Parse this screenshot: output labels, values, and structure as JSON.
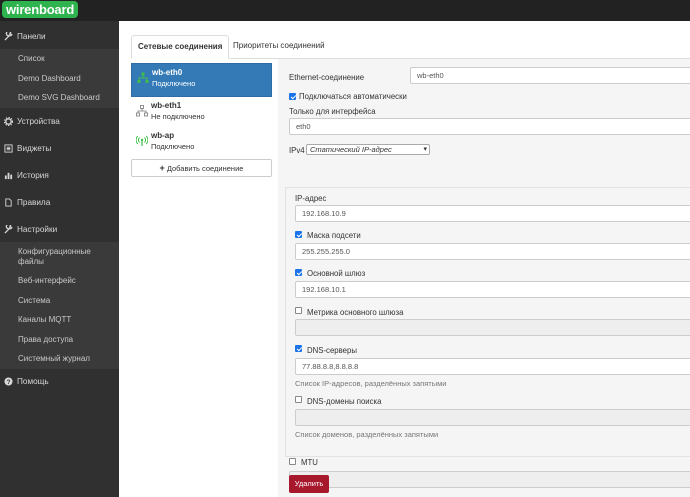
{
  "app": {
    "logo": "wirenboard"
  },
  "sidebar": {
    "panels": {
      "label": "Панели",
      "icon": "wrench-icon"
    },
    "panel_items": [
      "Список",
      "Demo Dashboard",
      "Demo SVG Dashboard"
    ],
    "devices": {
      "label": "Устройства",
      "icon": "gear-icon"
    },
    "widgets": {
      "label": "Виджеты",
      "icon": "list-icon"
    },
    "history": {
      "label": "История",
      "icon": "bar-chart-icon"
    },
    "rules": {
      "label": "Правила",
      "icon": "file-icon"
    },
    "settings": {
      "label": "Настройки",
      "icon": "wrench-icon"
    },
    "settings_items": [
      "Конфигурационные файлы",
      "Веб-интерфейс",
      "Система",
      "Каналы MQTT",
      "Права доступа",
      "Системный журнал"
    ],
    "help": {
      "label": "Помощь",
      "icon": "question-icon"
    }
  },
  "tabs": {
    "network": "Сетевые соединения",
    "priorities": "Приоритеты соединений"
  },
  "connections": [
    {
      "name": "wb-eth0",
      "status": "Подключено",
      "icon": "ethernet-icon"
    },
    {
      "name": "wb-eth1",
      "status": "Не подключено",
      "icon": "ethernet-icon"
    },
    {
      "name": "wb-ap",
      "status": "Подключено",
      "icon": "wifi-ap-icon"
    }
  ],
  "add_connection": "Добавить соединение",
  "form": {
    "ethernet_label": "Ethernet-соединение",
    "ethernet_value": "wb-eth0",
    "auto_connect_label": "Подключаться автоматически",
    "auto_connect": true,
    "interface_label": "Только для интерфейса",
    "interface_value": "eth0",
    "ipv4_label": "IPv4",
    "ipv4_mode": "Статический IP-адрес",
    "ip_label": "IP-адрес",
    "ip_value": "192.168.10.9",
    "netmask_label": "Маска подсети",
    "netmask_checked": true,
    "netmask_value": "255.255.255.0",
    "gateway_label": "Основной шлюз",
    "gateway_checked": true,
    "gateway_value": "192.168.10.1",
    "metric_label": "Метрика основного шлюза",
    "metric_checked": false,
    "metric_value": "",
    "dns_label": "DNS-серверы",
    "dns_checked": true,
    "dns_value": "77.88.8.8,8.8.8.8",
    "dns_help": "Список IP-адресов, разделённых запятыми",
    "dns_search_label": "DNS-домены поиска",
    "dns_search_checked": false,
    "dns_search_value": "",
    "dns_search_help": "Список доменов, разделённых запятыми",
    "mtu_label": "MTU",
    "mtu_checked": false,
    "mtu_value": "",
    "delete_label": "Удалить"
  },
  "colors": {
    "accent": "#337ab7",
    "brand": "#2eb34e",
    "danger": "#a8182d",
    "sidebar": "#303030"
  }
}
